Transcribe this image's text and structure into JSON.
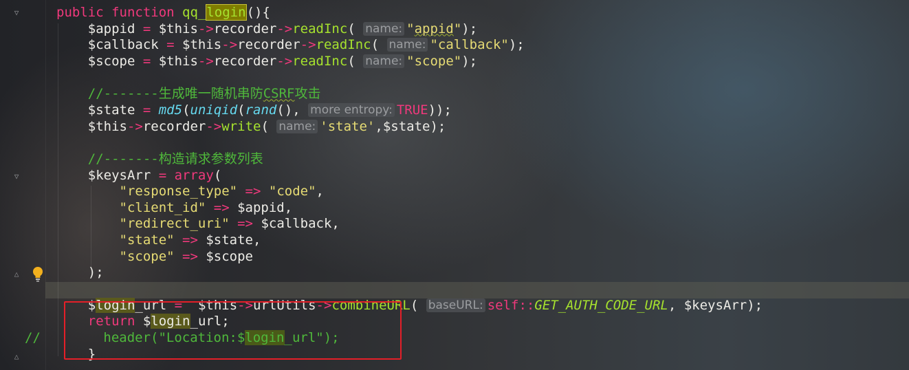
{
  "editor": {
    "lines": [
      [
        {
          "t": "public ",
          "c": "kw"
        },
        {
          "t": "function ",
          "c": "kw"
        },
        {
          "t": "qq_",
          "c": "fn"
        },
        {
          "t": "login",
          "c": "fn hlsel"
        },
        {
          "t": "(){",
          "c": "var"
        }
      ],
      [
        {
          "t": "    $appid ",
          "c": "var"
        },
        {
          "t": "= ",
          "c": "op"
        },
        {
          "t": "$this",
          "c": "var"
        },
        {
          "t": "->",
          "c": "op"
        },
        {
          "t": "recorder",
          "c": "var"
        },
        {
          "t": "->",
          "c": "op"
        },
        {
          "t": "readInc",
          "c": "fn"
        },
        {
          "t": "( ",
          "c": "var"
        },
        {
          "t": "name:",
          "c": "hint"
        },
        {
          "t": "\"",
          "c": "str"
        },
        {
          "t": "appid",
          "c": "str squig"
        },
        {
          "t": "\"",
          "c": "str"
        },
        {
          "t": ");",
          "c": "var"
        }
      ],
      [
        {
          "t": "    $callback ",
          "c": "var"
        },
        {
          "t": "= ",
          "c": "op"
        },
        {
          "t": "$this",
          "c": "var"
        },
        {
          "t": "->",
          "c": "op"
        },
        {
          "t": "recorder",
          "c": "var"
        },
        {
          "t": "->",
          "c": "op"
        },
        {
          "t": "readInc",
          "c": "fn"
        },
        {
          "t": "( ",
          "c": "var"
        },
        {
          "t": "name:",
          "c": "hint"
        },
        {
          "t": "\"callback\"",
          "c": "str"
        },
        {
          "t": ");",
          "c": "var"
        }
      ],
      [
        {
          "t": "    $scope ",
          "c": "var"
        },
        {
          "t": "= ",
          "c": "op"
        },
        {
          "t": "$this",
          "c": "var"
        },
        {
          "t": "->",
          "c": "op"
        },
        {
          "t": "recorder",
          "c": "var"
        },
        {
          "t": "->",
          "c": "op"
        },
        {
          "t": "readInc",
          "c": "fn"
        },
        {
          "t": "( ",
          "c": "var"
        },
        {
          "t": "name:",
          "c": "hint"
        },
        {
          "t": "\"scope\"",
          "c": "str"
        },
        {
          "t": ");",
          "c": "var"
        }
      ],
      [],
      [
        {
          "t": "    //-------生成唯一随机串防",
          "c": "cm"
        },
        {
          "t": "CSRF",
          "c": "cm squig"
        },
        {
          "t": "攻击",
          "c": "cm"
        }
      ],
      [
        {
          "t": "    $state ",
          "c": "var"
        },
        {
          "t": "= ",
          "c": "op"
        },
        {
          "t": "md5",
          "c": "ifn"
        },
        {
          "t": "(",
          "c": "var"
        },
        {
          "t": "uniqid",
          "c": "ifn"
        },
        {
          "t": "(",
          "c": "var"
        },
        {
          "t": "rand",
          "c": "ifn"
        },
        {
          "t": "(), ",
          "c": "var"
        },
        {
          "t": "more entropy:",
          "c": "hint"
        },
        {
          "t": "TRUE",
          "c": "cst"
        },
        {
          "t": "));",
          "c": "var"
        }
      ],
      [
        {
          "t": "    $this",
          "c": "var"
        },
        {
          "t": "->",
          "c": "op"
        },
        {
          "t": "recorder",
          "c": "var"
        },
        {
          "t": "->",
          "c": "op"
        },
        {
          "t": "write",
          "c": "fn"
        },
        {
          "t": "( ",
          "c": "var"
        },
        {
          "t": "name:",
          "c": "hint"
        },
        {
          "t": "'state'",
          "c": "str"
        },
        {
          "t": ",$state);",
          "c": "var"
        }
      ],
      [],
      [
        {
          "t": "    //-------构造请求参数列表",
          "c": "cm"
        }
      ],
      [
        {
          "t": "    $keysArr ",
          "c": "var"
        },
        {
          "t": "= ",
          "c": "op"
        },
        {
          "t": "array",
          "c": "kw"
        },
        {
          "t": "(",
          "c": "var"
        }
      ],
      [
        {
          "t": "        \"response_type\" ",
          "c": "str"
        },
        {
          "t": "=> ",
          "c": "op"
        },
        {
          "t": "\"code\"",
          "c": "str"
        },
        {
          "t": ",",
          "c": "var"
        }
      ],
      [
        {
          "t": "        \"client_id\" ",
          "c": "str"
        },
        {
          "t": "=> ",
          "c": "op"
        },
        {
          "t": "$appid,",
          "c": "var"
        }
      ],
      [
        {
          "t": "        \"redirect_uri\" ",
          "c": "str"
        },
        {
          "t": "=> ",
          "c": "op"
        },
        {
          "t": "$callback,",
          "c": "var"
        }
      ],
      [
        {
          "t": "        \"state\" ",
          "c": "str"
        },
        {
          "t": "=> ",
          "c": "op"
        },
        {
          "t": "$state,",
          "c": "var"
        }
      ],
      [
        {
          "t": "        \"scope\" ",
          "c": "str"
        },
        {
          "t": "=> ",
          "c": "op"
        },
        {
          "t": "$scope",
          "c": "var"
        }
      ],
      [
        {
          "t": "    );",
          "c": "var"
        }
      ],
      [],
      [
        {
          "t": "    $",
          "c": "var"
        },
        {
          "t": "login",
          "c": "var hl"
        },
        {
          "t": "_url ",
          "c": "var"
        },
        {
          "t": "=  ",
          "c": "op"
        },
        {
          "t": "$this",
          "c": "var"
        },
        {
          "t": "->",
          "c": "op"
        },
        {
          "t": "urlUtils",
          "c": "var"
        },
        {
          "t": "->",
          "c": "op"
        },
        {
          "t": "combineURL",
          "c": "fn"
        },
        {
          "t": "( ",
          "c": "var"
        },
        {
          "t": "baseURL:",
          "c": "hint"
        },
        {
          "t": "self",
          "c": "kw"
        },
        {
          "t": "::",
          "c": "op"
        },
        {
          "t": "GET_AUTH_CODE_URL",
          "c": "ital"
        },
        {
          "t": ", $keysArr);",
          "c": "var"
        }
      ],
      [
        {
          "t": "    ",
          "c": "var"
        },
        {
          "t": "return ",
          "c": "kw"
        },
        {
          "t": "$",
          "c": "var"
        },
        {
          "t": "login",
          "c": "var hl"
        },
        {
          "t": "_url;",
          "c": "var"
        }
      ],
      [
        {
          "t": "//        header(\"Location:$",
          "c": "cm"
        },
        {
          "t": "login",
          "c": "cm hlb"
        },
        {
          "t": "_url\");",
          "c": "cm"
        }
      ],
      [
        {
          "t": "    }",
          "c": "var"
        }
      ]
    ]
  },
  "gutter": {
    "fold_icon": "fold-arrow-icon",
    "intention_icon": "lightbulb-icon",
    "intention_color": "#f2b01e"
  },
  "annotation": {
    "color": "#e51f28"
  }
}
